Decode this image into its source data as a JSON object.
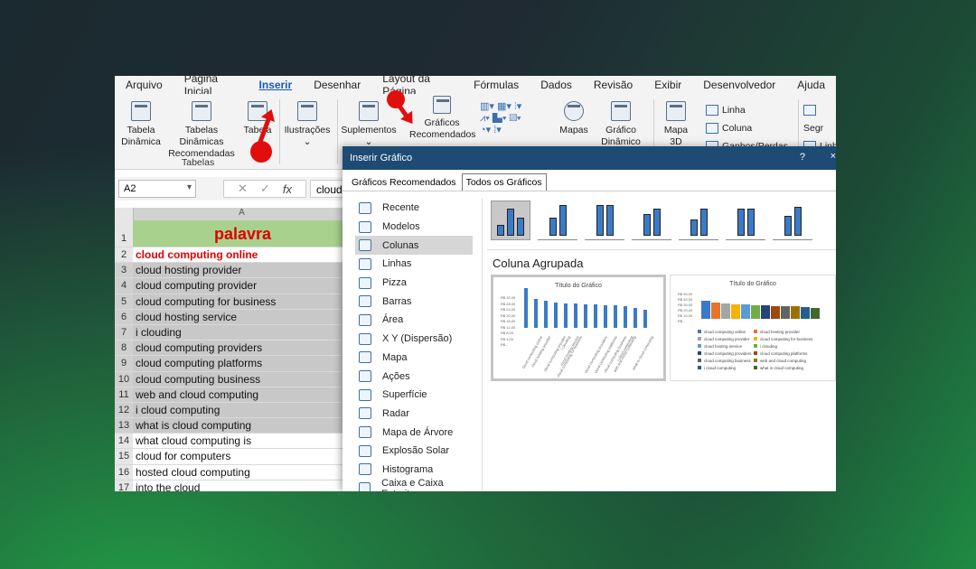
{
  "menu": [
    "Arquivo",
    "Página Inicial",
    "Inserir",
    "Desenhar",
    "Layout da Página",
    "Fórmulas",
    "Dados",
    "Revisão",
    "Exibir",
    "Desenvolvedor",
    "Ajuda"
  ],
  "ribbon": {
    "tabela_dinamica": "Tabela Dinâmica",
    "tabelas_recomendadas": "Tabelas Dinâmicas Recomendadas",
    "tabela": "Tabela",
    "group_tabelas": "Tabelas",
    "ilustracoes": "Ilustrações",
    "suplementos": "Suplementos",
    "graficos_rec": "Gráficos Recomendados",
    "mapas": "Mapas",
    "grafico_dinamico": "Gráfico Dinâmico",
    "mapa3d": "Mapa 3D",
    "linha": "Linha",
    "coluna": "Coluna",
    "ganhos": "Ganhos/Perdas",
    "seg": "Segr",
    "linh": "Linh"
  },
  "formula": {
    "namebox": "A2",
    "value": "cloud"
  },
  "sheet": {
    "column": "A",
    "header": "palavra",
    "rows": [
      {
        "n": "2",
        "t": "cloud computing online"
      },
      {
        "n": "3",
        "t": "cloud hosting provider"
      },
      {
        "n": "4",
        "t": "cloud computing provider"
      },
      {
        "n": "5",
        "t": "cloud computing for business"
      },
      {
        "n": "6",
        "t": "cloud hosting service"
      },
      {
        "n": "7",
        "t": "i clouding"
      },
      {
        "n": "8",
        "t": "cloud computing providers"
      },
      {
        "n": "9",
        "t": "cloud computing platforms"
      },
      {
        "n": "10",
        "t": "cloud computing business"
      },
      {
        "n": "11",
        "t": "web and cloud computing"
      },
      {
        "n": "12",
        "t": "i cloud computing"
      },
      {
        "n": "13",
        "t": "what is cloud computing"
      },
      {
        "n": "14",
        "t": "what cloud computing is"
      },
      {
        "n": "15",
        "t": "cloud for computers"
      },
      {
        "n": "16",
        "t": "hosted cloud computing"
      },
      {
        "n": "17",
        "t": "into the cloud"
      }
    ]
  },
  "dialog": {
    "title": "Inserir Gráfico",
    "help": "?",
    "close": "×",
    "tab_rec": "Gráficos Recomendados",
    "tab_all": "Todos os Gráficos",
    "types": [
      "Recente",
      "Modelos",
      "Colunas",
      "Linhas",
      "Pizza",
      "Barras",
      "Área",
      "X Y (Dispersão)",
      "Mapa",
      "Ações",
      "Superfície",
      "Radar",
      "Mapa de Árvore",
      "Explosão Solar",
      "Histograma",
      "Caixa e Caixa Estreita"
    ],
    "subtype": "Coluna Agrupada",
    "preview_title": "Título do Gráfico",
    "ylabels": [
      "R$ 32,00",
      "R$ 28,00",
      "R$ 24,00",
      "R$ 20,00",
      "R$ 16,00",
      "R$ 12,00",
      "R$ 8,00",
      "R$ 4,00",
      "R$ -"
    ],
    "ylabels2": [
      "R$ 50,00",
      "R$ 40,00",
      "R$ 30,00",
      "R$ 20,00",
      "R$ 10,00",
      "R$ -"
    ],
    "legend": [
      "cloud computing online",
      "cloud hosting provider",
      "cloud computing provider",
      "cloud computing for business",
      "cloud hosting service",
      "i clouding",
      "cloud computing providers",
      "cloud computing platforms",
      "cloud computing business",
      "web and cloud computing",
      "i cloud computing",
      "what is cloud computing"
    ]
  },
  "colors": {
    "accent": "#185abd",
    "dialog_title": "#1d4b73",
    "header_fill": "#a9d18e",
    "red": "#e00000",
    "bar": "#3a7bc8"
  }
}
